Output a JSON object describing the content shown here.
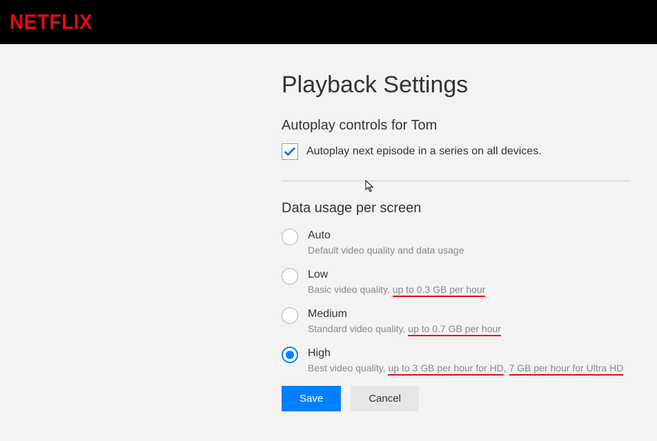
{
  "logo": "NETFLIX",
  "page_title": "Playback Settings",
  "autoplay": {
    "heading": "Autoplay controls for Tom",
    "checkbox_label": "Autoplay next episode in a series on all devices.",
    "checked": true
  },
  "data_usage": {
    "heading": "Data usage per screen",
    "options": [
      {
        "id": "auto",
        "title": "Auto",
        "desc_plain": "Default video quality and data usage",
        "selected": false
      },
      {
        "id": "low",
        "title": "Low",
        "desc_prefix": "Basic video quality, ",
        "desc_ul1": "up to 0.3 GB per hour",
        "selected": false
      },
      {
        "id": "medium",
        "title": "Medium",
        "desc_prefix": "Standard video quality, ",
        "desc_ul1": "up to 0.7 GB per hour",
        "selected": false
      },
      {
        "id": "high",
        "title": "High",
        "desc_prefix": "Best video quality, ",
        "desc_ul1": "up to 3 GB per hour for HD",
        "desc_sep": ", ",
        "desc_ul2": "7 GB per hour for Ultra HD",
        "selected": true
      }
    ]
  },
  "buttons": {
    "save": "Save",
    "cancel": "Cancel"
  }
}
